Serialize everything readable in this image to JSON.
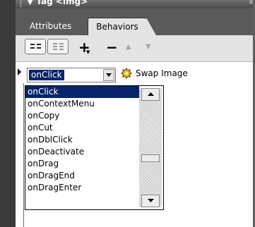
{
  "panel": {
    "title": "Tag <img>",
    "title_prefix_glyph": "▼"
  },
  "tabs": [
    {
      "label": "Attributes",
      "active": false
    },
    {
      "label": "Behaviors",
      "active": true
    }
  ],
  "toolbar": {
    "view_buttons": [
      "show-set-events-icon",
      "show-all-events-icon"
    ],
    "add_label": "+",
    "remove_label": "−",
    "move_up_label": "▲",
    "move_down_label": "▼"
  },
  "behavior_row": {
    "event": "onClick",
    "action": "Swap Image",
    "action_icon": "gear-icon"
  },
  "event_dropdown": {
    "items": [
      "onClick",
      "onContextMenu",
      "onCopy",
      "onCut",
      "onDblClick",
      "onDeactivate",
      "onDrag",
      "onDragEnd",
      "onDragEnter"
    ],
    "selected_index": 0,
    "scroll_position": 0.62
  },
  "colors": {
    "selection": "#0a246a",
    "panel_bg": "#e4e4e4",
    "dark_chrome": "#5a5a5a"
  }
}
